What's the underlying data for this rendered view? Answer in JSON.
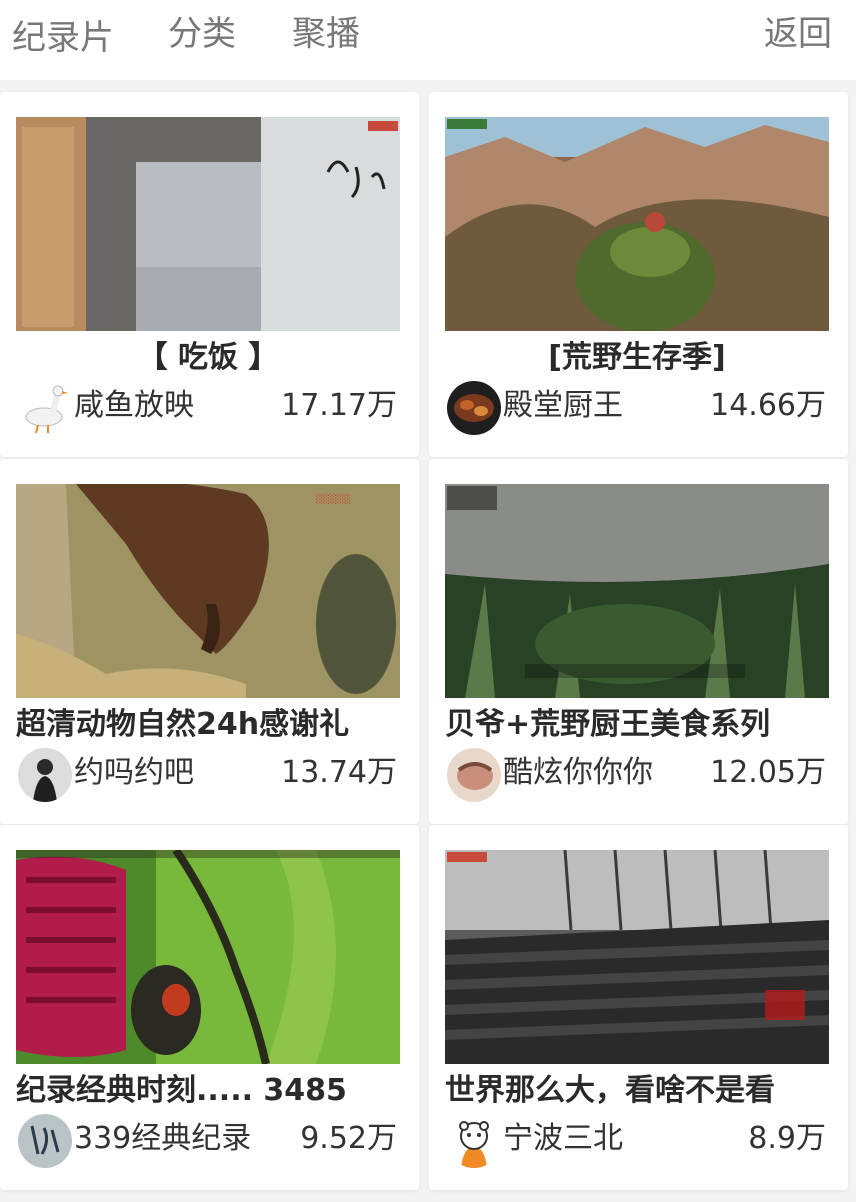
{
  "nav": {
    "items": [
      "纪录片",
      "分类",
      "聚播"
    ],
    "back_label": "返回"
  },
  "videos": [
    {
      "title": "【 吃饭 】",
      "uploader": "咸鱼放映",
      "views": "17.17万",
      "avatar_icon": "goose-icon"
    },
    {
      "title": "[荒野生存季]",
      "uploader": "殿堂厨王",
      "views": "14.66万",
      "avatar_icon": "food-avatar"
    },
    {
      "title": "超清动物自然24h感谢礼",
      "uploader": "约吗约吧",
      "views": "13.74万",
      "avatar_icon": "person-avatar"
    },
    {
      "title": "贝爷+荒野厨王美食系列",
      "uploader": "酷炫你你你",
      "views": "12.05万",
      "avatar_icon": "face-avatar"
    },
    {
      "title": "纪录经典时刻..... 3485",
      "uploader": "339经典纪录",
      "views": "9.52万",
      "avatar_icon": "calligraphy-avatar"
    },
    {
      "title": "世界那么大，看啥不是看",
      "uploader": "宁波三北",
      "views": "8.9万",
      "avatar_icon": "cartoon-bear-avatar"
    }
  ]
}
